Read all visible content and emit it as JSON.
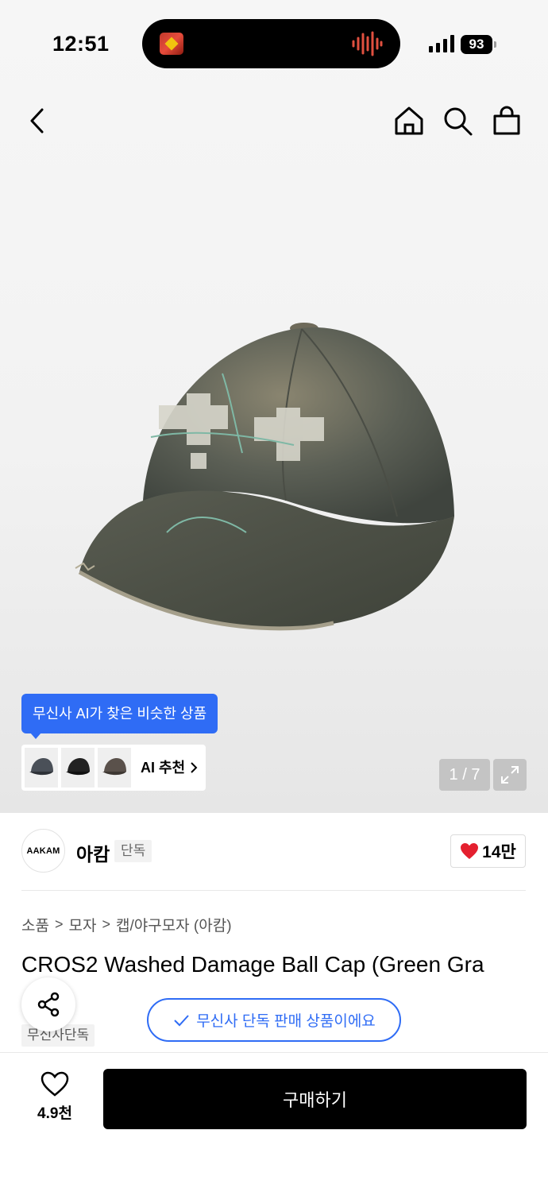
{
  "status_bar": {
    "time": "12:51",
    "battery": "93"
  },
  "nav": {
    "icons": [
      "back-icon",
      "home-icon",
      "search-icon",
      "shopping-bag-icon"
    ]
  },
  "gallery": {
    "page_indicator": "1 / 7"
  },
  "ai_recommend": {
    "tooltip": "무신사 AI가 찾은 비슷한 상품",
    "label": "AI 추천"
  },
  "brand": {
    "logo_text": "AAKAM",
    "name": "아캄",
    "badge": "단독",
    "likes": "14만"
  },
  "breadcrumb": [
    "소품",
    "모자",
    "캡/야구모자 (아캄)"
  ],
  "product": {
    "title": "CROS2 Washed Damage Ball Cap (Green Gra",
    "exclusive_tag": "무신사단독",
    "exclusive_notice": "무신사 단독 판매 상품이에요"
  },
  "bottom_bar": {
    "wish_count": "4.9천",
    "buy_label": "구매하기"
  },
  "colors": {
    "accent_blue": "#2f6cf5",
    "heart_red": "#e4202f"
  }
}
